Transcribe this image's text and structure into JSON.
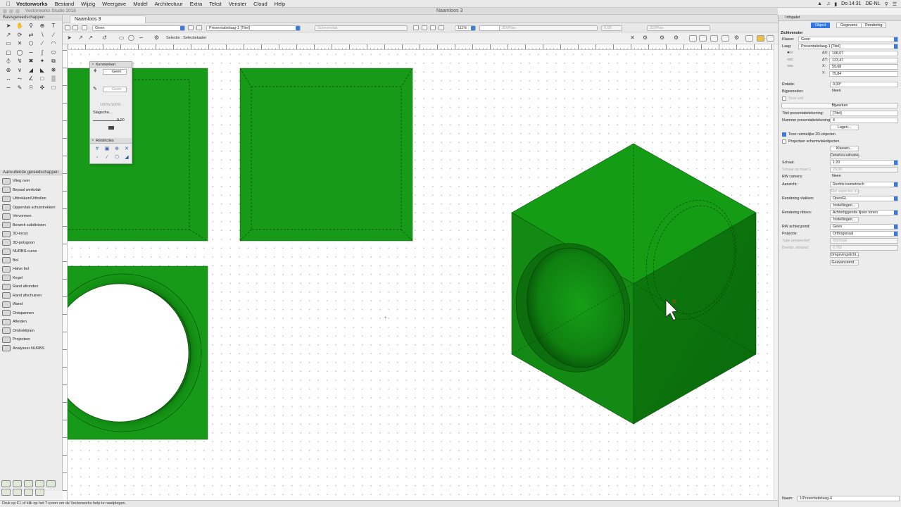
{
  "menubar": {
    "app": "Vectorworks",
    "items": [
      "Bestand",
      "Wijzig",
      "Weergave",
      "Model",
      "Architectuur",
      "Extra",
      "Tekst",
      "Venster",
      "Cloud",
      "Help"
    ],
    "time": "Do 14:31",
    "locale": "DE-NL"
  },
  "window": {
    "app_title": "Vectorworks Studio 2018",
    "doc_title": "Naamloos 3"
  },
  "doctab": {
    "label": "Naamloos 3"
  },
  "viewbar": {
    "class_field": "Geen",
    "layer_field": "Presentatielaag-1 [Titel]",
    "render_field": "Schermvlak",
    "zoom": "111%",
    "view_field": "2D/Plan",
    "scale_field": "0.00",
    "plane_field": "2D/Plan"
  },
  "modebar": {
    "label": "Selectie : Selectiekader"
  },
  "tools": {
    "basic_title": "Basisgereedschappen",
    "additional_title": "Aanvullende gereedschappen",
    "additional_items": [
      "Vlieg over",
      "Bepaal werkvlak",
      "Uittrekken/Uithollen",
      "Oppervlak schuintrekken",
      "Vervormen",
      "Bewerk subdivision",
      "3D-locus",
      "3D-polygoon",
      "NURBS-curve",
      "Bol",
      "Halve bol",
      "Kegel",
      "Rand afronden",
      "Rand afschuinen",
      "Wand",
      "Ontspannen",
      "Afleiden",
      "Omtreklijnen",
      "Projecteer",
      "Analyseer NURBS"
    ]
  },
  "attributes": {
    "title": "Kenmerken",
    "fill": "Geen",
    "pen": "Geen",
    "opacity": "100%/100%",
    "shadow_label": "Slagscha...",
    "line_weight": "0.00",
    "restrictions_title": "Restricties"
  },
  "status": {
    "hint": "Druk op F1 of klik op het ?-icoon om de Vectorworks help te raadplegen."
  },
  "object_info": {
    "title": "Infopalet",
    "tabs": [
      "Object",
      "Gegevens",
      "Rendering"
    ],
    "section": "Zichtvenster",
    "class_label": "Klasse:",
    "class_value": "Geen",
    "layer_label": "Laag:",
    "layer_value": "Presentatielaag-1 [Titel]",
    "coords": [
      {
        "label": "ΔX:",
        "value": "108,07"
      },
      {
        "label": "ΔY:",
        "value": "123,47"
      },
      {
        "label": "X:",
        "value": "55,68"
      },
      {
        "label": "Y:",
        "value": "75,84"
      }
    ],
    "rotation_label": "Rotatie:",
    "rotation_value": "0,00°",
    "clip_label": "Bijgesneden:",
    "clip_value": "Neen",
    "show_clip": "Toon snit",
    "edit_button": "Bijwerken",
    "title_label": "Titel presentatietekening:",
    "title_value": "[Titel]",
    "number_label": "Nummer presentatietekening:",
    "number_value": "4",
    "layers_button": "Lagen...",
    "cb_3d": "Toon ruimtelijke 2D-objecten",
    "cb_screen": "Projecteer schermvlakobjecten",
    "classes_button": "Klassen...",
    "detail_button": "Detailvisualisatie...",
    "scale_label": "Schaal:",
    "scale_value": "1:20",
    "scale_meas_label": "Schaal op maat 1:",
    "scale_meas_value": "20,00",
    "camera_label": "RW camera:",
    "camera_value": "Neen",
    "view_label": "Aanzicht:",
    "view_value": "Rechts isometrisch",
    "link_label": "Stel aspecten in...",
    "bg_render_label": "Rendering vlakken:",
    "bg_render_value": "OpenGL",
    "settings1": "Instellingen...",
    "fg_render_label": "Rendering ribben:",
    "fg_render_value": "Achterliggende lijnen tonen",
    "settings2": "Instellingen...",
    "rw_bg_label": "RW achtergrond:",
    "rw_bg_value": "Geen",
    "projection_label": "Projectie:",
    "projection_value": "Orthogonaal",
    "persp_label": "Type perspectief:",
    "persp_value": "Normaal",
    "dist_label": "Beeldp. afstand:",
    "dist_value": "0,762",
    "env_button": "Omgevingslicht...",
    "adv_button": "Geavanceerd...",
    "name_label": "Naam:",
    "name_value": "1/Presentatielaag-4"
  },
  "colors": {
    "cube_front": "#138a14",
    "cube_top": "#149c15",
    "cube_right": "#0e760f",
    "accent": "#2f78e3"
  }
}
